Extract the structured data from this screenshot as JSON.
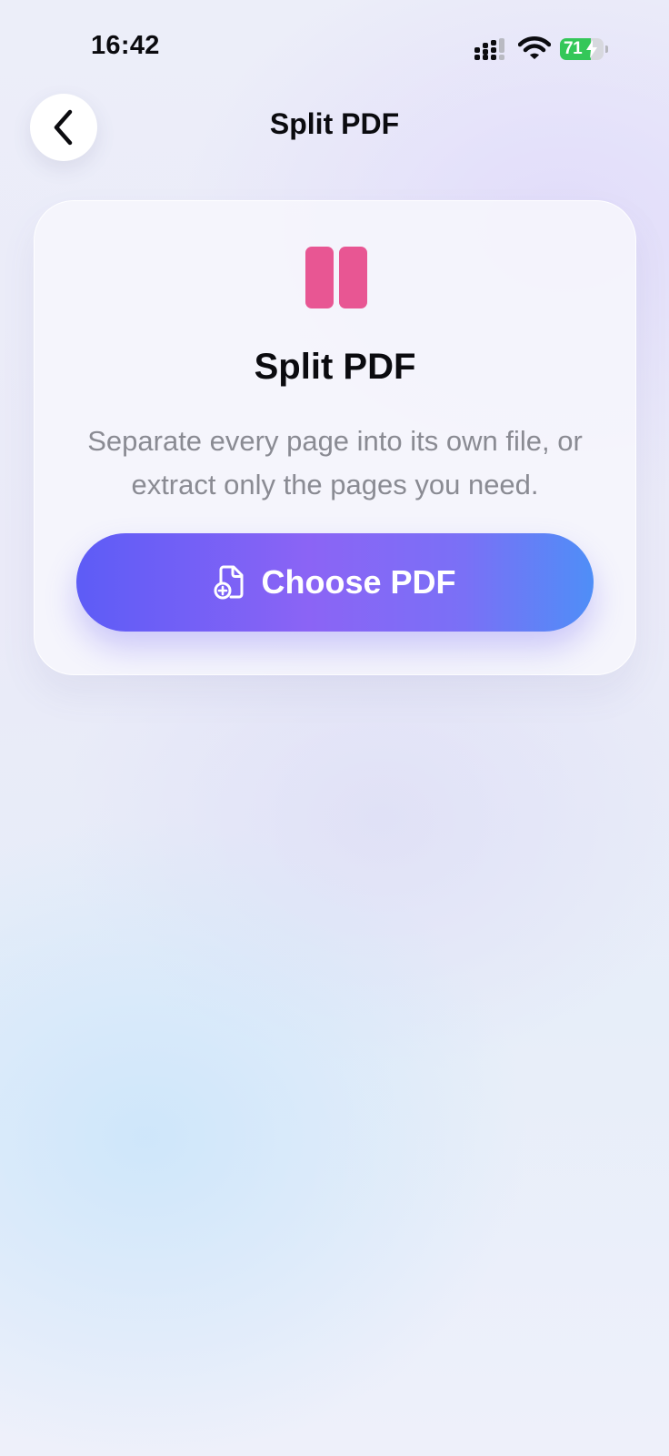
{
  "status_bar": {
    "time": "16:42",
    "battery_percent": "71",
    "battery_level": 0.71,
    "charging": true,
    "icons": [
      "signal-icon",
      "wifi-icon",
      "battery-icon",
      "charging-bolt-icon"
    ]
  },
  "nav": {
    "back_icon": "chevron-left-icon",
    "title": "Split PDF"
  },
  "card": {
    "icon": "split-pages-icon",
    "title": "Split PDF",
    "description": "Separate every page into its own file, or extract only the pages you need.",
    "button_icon": "document-add-icon",
    "button_label": "Choose PDF"
  },
  "colors": {
    "accent_start": "#5d5cf6",
    "accent_mid": "#8b64f5",
    "accent_end": "#4f8ef7",
    "split_icon": "#e85693",
    "battery_green": "#34c759",
    "secondary_text": "#8a8b93"
  }
}
